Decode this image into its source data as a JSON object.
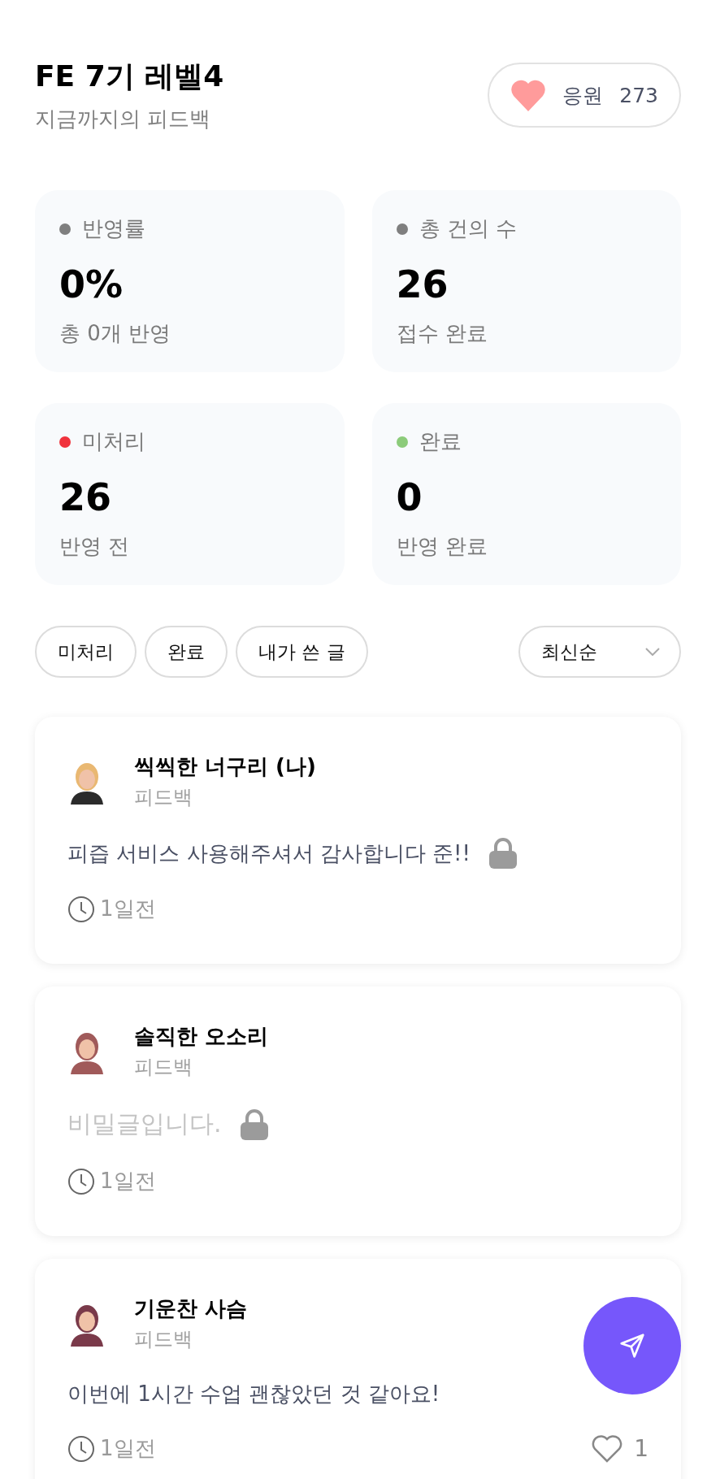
{
  "header": {
    "title": "FE 7기 레벨4",
    "subtitle": "지금까지의 피드백",
    "cheer": {
      "label": "응원",
      "count": "273"
    }
  },
  "stats": [
    {
      "label": "반영률",
      "value": "0%",
      "caption": "총 0개 반영",
      "color": "#7f7f7f"
    },
    {
      "label": "총 건의 수",
      "value": "26",
      "caption": "접수 완료",
      "color": "#7f7f7f"
    },
    {
      "label": "미처리",
      "value": "26",
      "caption": "반영 전",
      "color": "#f0323c"
    },
    {
      "label": "완료",
      "value": "0",
      "caption": "반영 완료",
      "color": "#8ccb7a"
    }
  ],
  "filters": [
    {
      "label": "미처리",
      "selected": false
    },
    {
      "label": "완료",
      "selected": false
    },
    {
      "label": "내가 쓴 글",
      "selected": false
    }
  ],
  "sort": {
    "value": "최신순"
  },
  "posts": [
    {
      "author": "씩씩한 너구리 (나)",
      "category": "피드백",
      "text": "피즙 서비스 사용해주셔서 감사합니다 준!!",
      "secret": false,
      "locked": true,
      "time": "1일전"
    },
    {
      "author": "솔직한 오소리",
      "category": "피드백",
      "text": "비밀글입니다.",
      "secret": true,
      "locked": true,
      "time": "1일전"
    },
    {
      "author": "기운찬 사슴",
      "category": "피드백",
      "text": "이번에 1시간 수업 괜찮았던 것 같아요!",
      "secret": false,
      "locked": false,
      "time": "1일전",
      "likes": "1"
    }
  ]
}
